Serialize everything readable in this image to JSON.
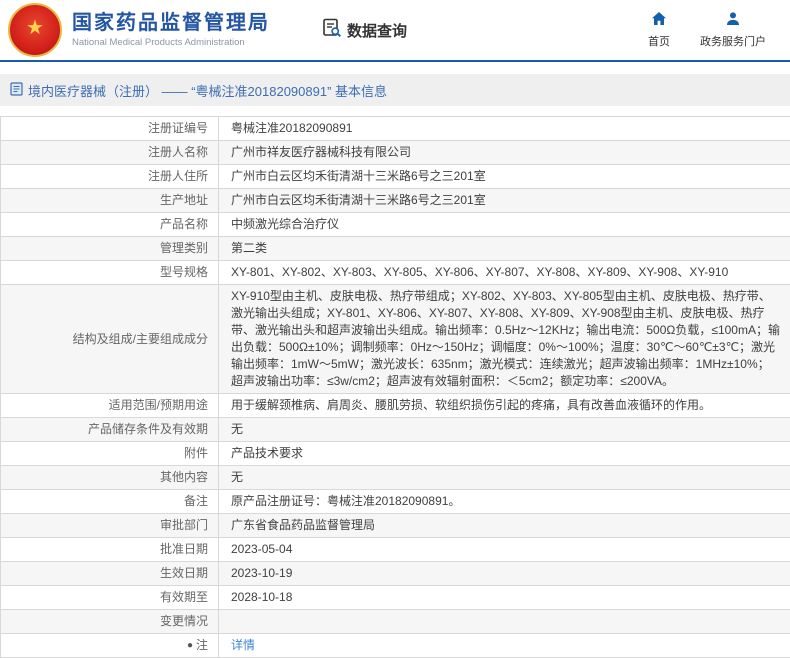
{
  "header": {
    "title_cn": "国家药品监督管理局",
    "title_en": "National Medical Products Administration",
    "data_query_label": "数据查询",
    "nav": [
      {
        "label": "首页",
        "icon": "home-icon"
      },
      {
        "label": "政务服务门户",
        "icon": "user-icon"
      }
    ]
  },
  "breadcrumb": {
    "icon": "document-icon",
    "text": "境内医疗器械（注册） —— “粤械注准20182090891” 基本信息"
  },
  "table": {
    "rows": [
      {
        "label": "注册证编号",
        "value": "粤械注准20182090891"
      },
      {
        "label": "注册人名称",
        "value": "广州市祥友医疗器械科技有限公司"
      },
      {
        "label": "注册人住所",
        "value": "广州市白云区均禾街清湖十三米路6号之三201室"
      },
      {
        "label": "生产地址",
        "value": "广州市白云区均禾街清湖十三米路6号之三201室"
      },
      {
        "label": "产品名称",
        "value": "中频激光综合治疗仪"
      },
      {
        "label": "管理类别",
        "value": "第二类"
      },
      {
        "label": "型号规格",
        "value": "XY-801、XY-802、XY-803、XY-805、XY-806、XY-807、XY-808、XY-809、XY-908、XY-910"
      },
      {
        "label": "结构及组成/主要组成成分",
        "value": "XY-910型由主机、皮肤电极、热疗带组成；XY-802、XY-803、XY-805型由主机、皮肤电极、热疗带、激光输出头组成；XY-801、XY-806、XY-807、XY-808、XY-809、XY-908型由主机、皮肤电极、热疗带、激光输出头和超声波输出头组成。输出频率：0.5Hz～12KHz；输出电流：500Ω负载，≤100mA；输出负载：500Ω±10%；调制频率：0Hz～150Hz；调幅度：0%～100%；温度：30℃～60℃±3℃；激光输出频率：1mW～5mW；激光波长：635nm；激光模式：连续激光；超声波输出频率：1MHz±10%；超声波输出功率：≤3w/cm2；超声波有效辐射面积：＜5cm2；额定功率：≤200VA。"
      },
      {
        "label": "适用范围/预期用途",
        "value": "用于缓解颈椎病、肩周炎、腰肌劳损、软组织损伤引起的疼痛，具有改善血液循环的作用。"
      },
      {
        "label": "产品储存条件及有效期",
        "value": "无"
      },
      {
        "label": "附件",
        "value": "产品技术要求"
      },
      {
        "label": "其他内容",
        "value": "无"
      },
      {
        "label": "备注",
        "value": "原产品注册证号：粤械注准20182090891。"
      },
      {
        "label": "审批部门",
        "value": "广东省食品药品监督管理局"
      },
      {
        "label": "批准日期",
        "value": "2023-05-04"
      },
      {
        "label": "生效日期",
        "value": "2023-10-19"
      },
      {
        "label": "有效期至",
        "value": "2028-10-18"
      },
      {
        "label": "变更情况",
        "value": ""
      },
      {
        "label": "注",
        "label_icon": "dot-icon",
        "value": "详情",
        "link": true
      }
    ]
  },
  "colors": {
    "brand_blue": "#2456a4",
    "nav_icon_blue": "#1660ab",
    "link_blue": "#3f87d6",
    "breadcrumb_text": "#3c6eb4",
    "header_divider": "#1a5cab",
    "row_stripe": "#f6f6f7",
    "border": "#d8d8d8"
  }
}
